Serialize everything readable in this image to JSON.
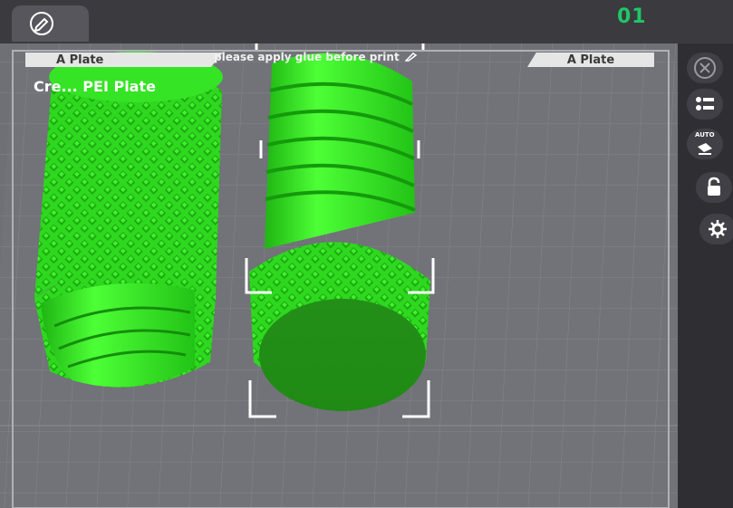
{
  "plate": {
    "number": "01",
    "tab_left_label": "A Plate",
    "tab_right_label": "A Plate",
    "note_text": "please apply glue before print",
    "title": "Cre... PEI Plate"
  },
  "toolbar": {
    "edit_icon": "pencil-icon"
  },
  "side_panel": {
    "buttons": [
      {
        "icon": "close-icon"
      },
      {
        "icon": "objects-list-icon"
      },
      {
        "icon": "auto-arrange-icon",
        "label": "AUTO"
      },
      {
        "icon": "lock-icon"
      },
      {
        "icon": "gear-icon"
      }
    ]
  },
  "colors": {
    "accent": "#20c767",
    "model": "#2be21c",
    "plate_bg": "#6e6e75"
  }
}
